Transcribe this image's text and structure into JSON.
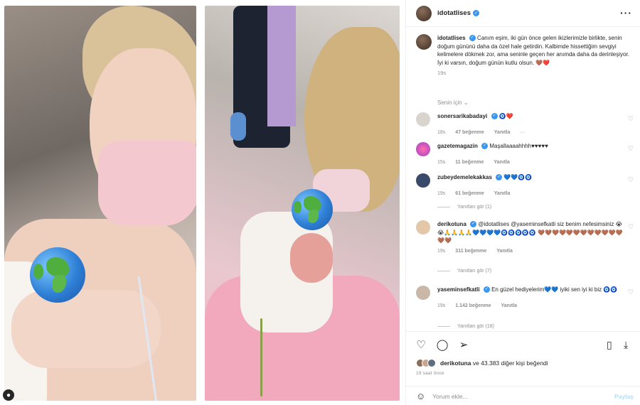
{
  "post": {
    "username": "idotatlises",
    "more_icon": "more-horizontal-icon"
  },
  "caption": {
    "username": "idotatlises",
    "text": "Canım eşim, iki gün önce gelen ikizlerimizle birlikte, senin doğum gününü daha da özel hale getirdin. Kalbimde hissettiğim sevgiyi kelimelere dökmek zor, ama seninle geçen her anımda daha da derinleşiyor. İyi ki varsın, doğum günün kutlu olsun. 🤎❤️",
    "time": "19s"
  },
  "filter_label": "Senin için ⌄",
  "comments": [
    {
      "username": "sonersarikabadayi",
      "text": "🧿❤️",
      "time": "18s",
      "likes": "47 beğenme",
      "reply": "Yanıtla",
      "extra": "···",
      "replies_label": ""
    },
    {
      "username": "gazetemagazin",
      "text": "Maşallaaaahhhh♥♥♥♥♥",
      "time": "15s",
      "likes": "11 beğenme",
      "reply": "Yanıtla",
      "extra": "",
      "replies_label": ""
    },
    {
      "username": "zubeydemelekakkas",
      "text": "💙💙🧿🧿",
      "time": "19s",
      "likes": "61 beğenme",
      "reply": "Yanıtla",
      "extra": "",
      "replies_label": "Yanıtları gör (1)"
    },
    {
      "username": "derikotuna",
      "text": "@idotatlises @yaseminsefkatli siz benim nefesimsiniz 😭😭🙏🙏🙏🙏💙💙💙💙🧿🧿🧿🧿🧿 🤎🤎🤎🤎🤎🤎🤎🤎🤎🤎🤎🤎🤎🤎",
      "time": "19s",
      "likes": "311 beğenme",
      "reply": "Yanıtla",
      "extra": "",
      "replies_label": "Yanıtları gör (7)"
    },
    {
      "username": "yaseminsefkatli",
      "text": "En güzel hediyelerim💙💙 iyiki sen iyi ki biz 🧿🧿",
      "time": "19s",
      "likes": "1.142 beğenme",
      "reply": "Yanıtla",
      "extra": "",
      "replies_label": "Yanıtları gör (18)"
    }
  ],
  "actions": {
    "like_icon": "heart-icon",
    "comment_icon": "comment-icon",
    "share_icon": "send-icon",
    "save_icon": "bookmark-icon",
    "download_icon": "download-icon"
  },
  "likes_summary": {
    "username": "derikotuna",
    "rest": " ve 43.383 diğer kişi beğendi"
  },
  "time_ago": "19 saat önce",
  "comment_input": {
    "placeholder": "Yorum ekle...",
    "post_label": "Paylaş"
  },
  "colors": {
    "verified": "#3897f0",
    "muted_text": "#8e8e8e",
    "post_button": "#b2dffc"
  }
}
